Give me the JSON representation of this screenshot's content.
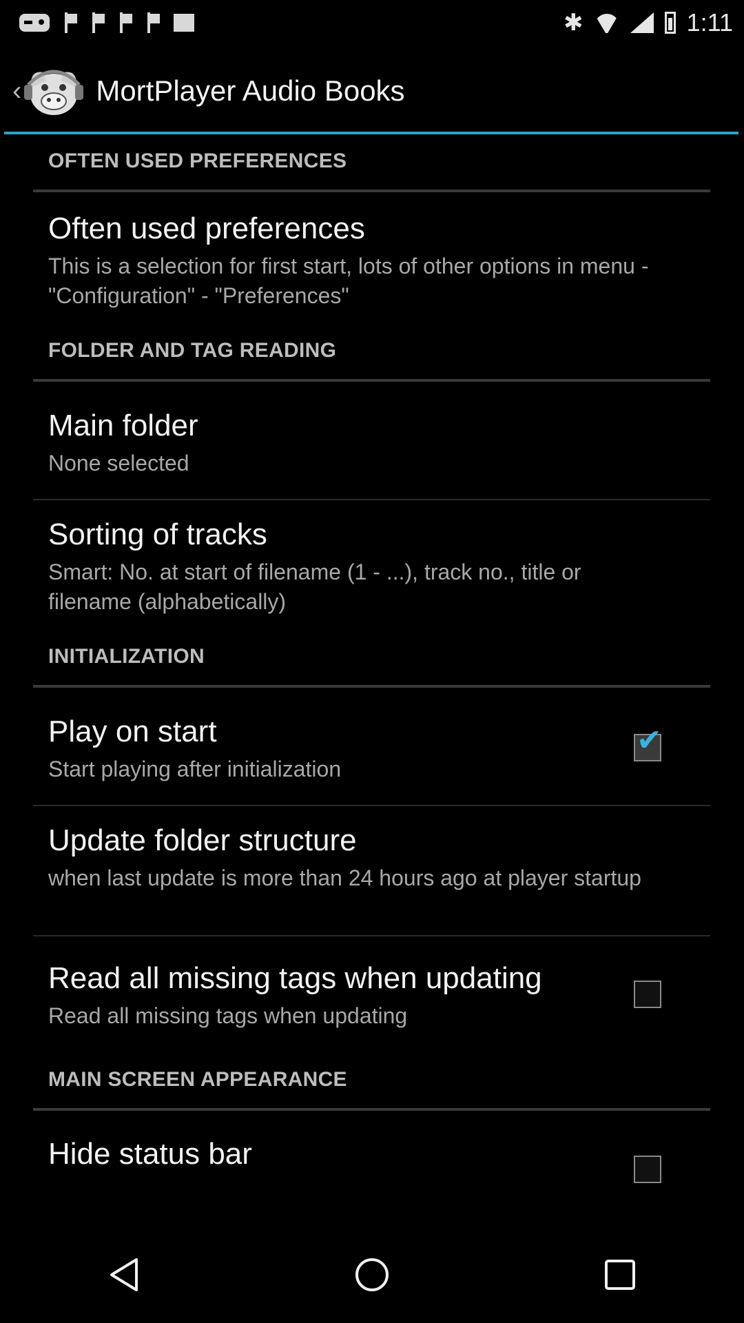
{
  "status_bar": {
    "time": "1:11",
    "icons": [
      "game-controller-icon",
      "flag-icon",
      "flag-icon",
      "flag-icon",
      "flag-icon",
      "square-icon",
      "bluetooth-icon",
      "wifi-icon",
      "signal-icon",
      "battery-icon"
    ]
  },
  "app_bar": {
    "title": "MortPlayer Audio Books",
    "back_glyph": "‹",
    "accent": "#2ea2c8"
  },
  "sections": {
    "often_used": {
      "header": "OFTEN USED PREFERENCES",
      "items": [
        {
          "title": "Often used preferences",
          "summary": "This is a selection for first start, lots of other options in menu - \"Configuration\" - \"Preferences\""
        }
      ]
    },
    "folder_tag": {
      "header": "FOLDER AND TAG READING",
      "items": [
        {
          "title": "Main folder",
          "summary": "None selected"
        },
        {
          "title": "Sorting of tracks",
          "summary": "Smart: No. at start of filename (1 - ...), track no., title or filename (alphabetically)"
        }
      ]
    },
    "initialization": {
      "header": "INITIALIZATION",
      "items": [
        {
          "title": "Play on start",
          "summary": "Start playing after initialization",
          "checked": true
        },
        {
          "title": "Update folder structure",
          "summary": "when last update is more than 24 hours ago at player startup"
        },
        {
          "title": "Read all missing tags when updating",
          "summary": "Read all missing tags when updating",
          "checked": false
        }
      ]
    },
    "appearance": {
      "header": "MAIN SCREEN APPEARANCE",
      "items": [
        {
          "title": "Hide status bar",
          "checked": false
        }
      ]
    }
  },
  "nav_bar": {
    "buttons": [
      "back-icon",
      "home-icon",
      "recents-icon"
    ]
  }
}
